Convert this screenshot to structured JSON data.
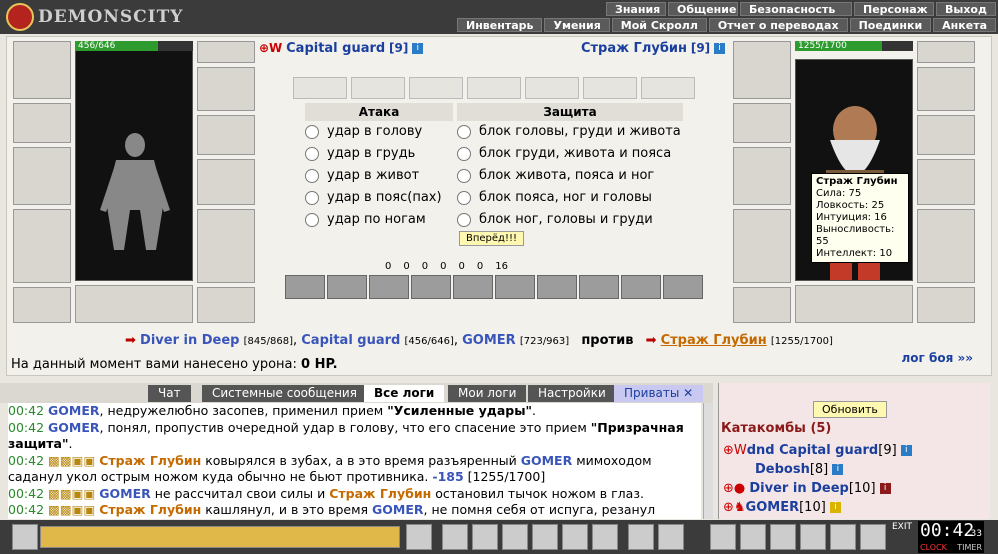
{
  "logo": {
    "text": "DEMONSCITY"
  },
  "menu": {
    "row1": [
      "Знания",
      "Общение",
      "Безопасность",
      "Персонаж",
      "Выход"
    ],
    "row2": [
      "Инвентарь",
      "Умения",
      "Мой Скролл",
      "Отчет о переводах",
      "Поединки",
      "Анкета"
    ]
  },
  "left_player": {
    "name": "Capital guard",
    "level": "[9]",
    "hp": "456/646",
    "hp_fraction": 0.706
  },
  "right_player": {
    "name": "Страж Глубин",
    "level": "[9]",
    "hp": "1255/1700",
    "hp_fraction": 0.738
  },
  "attack": {
    "title": "Атака",
    "options": [
      "удар в голову",
      "удар в грудь",
      "удар в живот",
      "удар в пояс(пах)",
      "удар по ногам"
    ]
  },
  "defense": {
    "title": "Защита",
    "options": [
      "блок головы, груди и живота",
      "блок груди, живота и пояса",
      "блок живота, пояса и ног",
      "блок пояса, ног и головы",
      "блок ног, головы и груди"
    ]
  },
  "forward_button": "Вперёд!!!",
  "stats_row": [
    "0",
    "0",
    "0",
    "0",
    "0",
    "0",
    "16"
  ],
  "tooltip": {
    "name": "Страж Глубин",
    "lines": [
      "Сила: 75",
      "Ловкость: 25",
      "Интуиция: 16",
      "Выносливость: 55",
      "Интеллект: 10"
    ]
  },
  "battle": {
    "team1": [
      {
        "name": "Diver in Deep",
        "hp": "[845/868]"
      },
      {
        "name": "Capital guard",
        "hp": "[456/646]"
      },
      {
        "name": "GOMER",
        "hp": "[723/963]"
      }
    ],
    "vs": "против",
    "team2": [
      {
        "name": "Страж Глубин",
        "hp": "[1255/1700]"
      }
    ],
    "damage_label": "На данный момент вами нанесено урона:",
    "damage_value": "0 HP.",
    "log_link": "лог боя »»"
  },
  "chat_tabs": [
    "Чат",
    "Системные сообщения",
    "Все логи",
    "Мои логи",
    "Настройки",
    "Приваты ✕"
  ],
  "log": [
    {
      "time": "00:42",
      "parts": [
        "GOMER",
        ", недружелюбно засопев, применил прием ",
        "\"Усиленные удары\"",
        "."
      ]
    },
    {
      "time": "00:42",
      "parts": [
        "GOMER",
        ", понял, пропустив очередной удар в голову, что его спасение это прием ",
        "\"Призрачная защита\"",
        "."
      ]
    },
    {
      "time": "00:42",
      "parts": [
        "Страж Глубин",
        " ковырялся в зубах, а в это время разъяренный ",
        "GOMER",
        " мимоходом саданул укол острым ножом куда обычно не бьют противника. ",
        "-185",
        " [1255/1700]"
      ]
    },
    {
      "time": "00:42",
      "parts": [
        "GOMER",
        " не рассчитал свои силы и ",
        "Страж Глубин",
        " остановил тычок ножом в глаз."
      ]
    },
    {
      "time": "00:42",
      "parts": [
        "Страж Глубин",
        " кашлянул, и в это время ",
        "GOMER",
        ", не помня себя от испуга, резанул"
      ]
    }
  ],
  "right_panel": {
    "refresh": "Обновить",
    "location": "Катакомбы (5)",
    "players": [
      {
        "name": "dnd Capital guard",
        "level": "[9]"
      },
      {
        "name": "Debosh",
        "level": "[8]"
      },
      {
        "name": "Diver in Deep",
        "level": "[10]"
      },
      {
        "name": "GOMER",
        "level": "[10]"
      }
    ]
  },
  "clock": {
    "time": "00:42",
    "seconds": "33",
    "labels": [
      "CLOCK",
      "TIMER"
    ],
    "exit": "EXIT"
  }
}
